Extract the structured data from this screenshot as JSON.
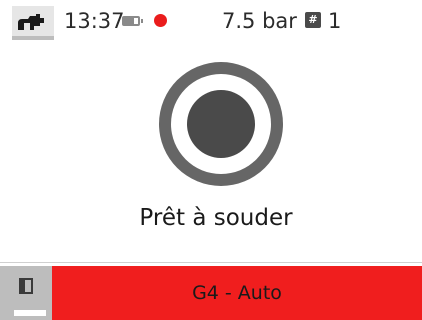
{
  "status_bar": {
    "time": "13:37",
    "pressure": "7.5 bar",
    "job_symbol": "#",
    "job_number": "1",
    "recording_color": "#ea1c1c",
    "icons": [
      "welder-mode-icon",
      "battery-icon",
      "recording-indicator-icon",
      "job-number-icon"
    ]
  },
  "main": {
    "status_text": "Prêt à souder"
  },
  "bottom_bar": {
    "mode_label": "G4 - Auto",
    "accent_color": "#f01e1e",
    "icons": [
      "panel-toggle-icon"
    ]
  }
}
